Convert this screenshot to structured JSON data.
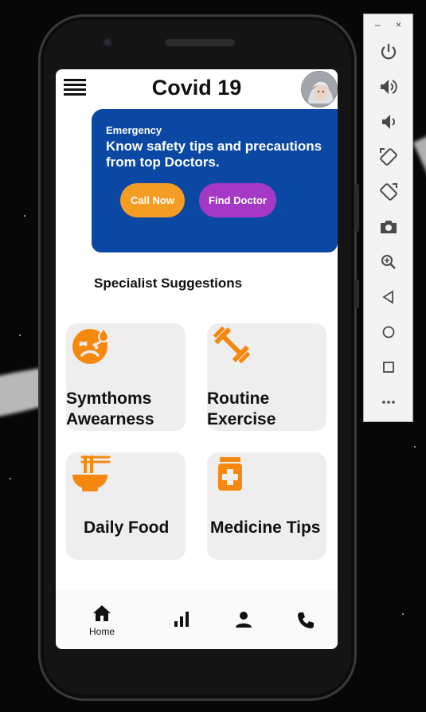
{
  "app": {
    "title": "Covid 19"
  },
  "banner": {
    "subtitle": "Emergency",
    "headline": "Know safety tips and precautions from top Doctors.",
    "call_label": "Call Now",
    "doctor_label": "Find Doctor",
    "bg_color": "#0a48a3",
    "call_color": "#f59d22",
    "doctor_color": "#a539c6"
  },
  "section": {
    "title": "Specialist Suggestions"
  },
  "cards": [
    {
      "line1": "Symthoms",
      "line2": "Awearness",
      "icon": "sick-face-icon"
    },
    {
      "line1": "Routine",
      "line2": "Exercise",
      "icon": "dumbbell-icon"
    },
    {
      "line1": "Daily Food",
      "line2": "",
      "icon": "noodle-bowl-icon"
    },
    {
      "line1": "Medicine Tips",
      "line2": "",
      "icon": "medicine-bottle-icon"
    }
  ],
  "accent_color": "#f5880f",
  "bottom_nav": {
    "items": [
      {
        "label": "Home",
        "icon": "home-icon"
      },
      {
        "label": "",
        "icon": "bar-chart-icon"
      },
      {
        "label": "",
        "icon": "person-icon"
      },
      {
        "label": "",
        "icon": "phone-icon"
      }
    ]
  },
  "emulator_toolbar": {
    "minimize": "–",
    "close": "×",
    "buttons": [
      "power-icon",
      "volume-up-icon",
      "volume-down-icon",
      "rotate-left-icon",
      "rotate-right-icon",
      "camera-icon",
      "zoom-icon",
      "back-icon",
      "home-circle-icon",
      "overview-icon",
      "more-icon"
    ]
  }
}
